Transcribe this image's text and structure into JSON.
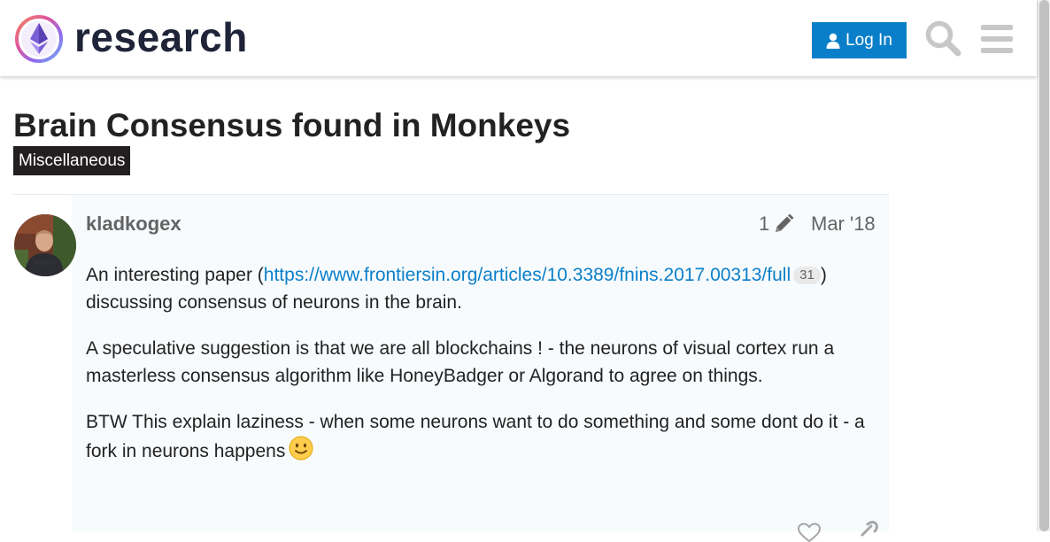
{
  "header": {
    "brand": "research",
    "logo_icon": "ethereum-research-logo-icon",
    "login_label": "Log In",
    "login_icon": "user-icon",
    "search_icon": "search-icon",
    "menu_icon": "hamburger-menu-icon",
    "login_color": "#0a7fc9"
  },
  "topic": {
    "title": "Brain Consensus found in Monkeys",
    "category": "Miscellaneous",
    "category_color": "#231f20"
  },
  "post": {
    "username": "kladkogex",
    "edit_count": "1",
    "edit_icon": "pencil-icon",
    "date": "Mar '18",
    "paragraphs": {
      "p1_before": "An interesting paper (",
      "p1_link": "https://www.frontiersin.org/articles/10.3389/fnins.2017.00313/full",
      "p1_clicks": "31",
      "p1_after": ") discussing consensus of neurons in the brain.",
      "p2": "A speculative suggestion is that we are all blockchains ! - the neurons of visual cortex run a masterless consensus algorithm like HoneyBadger or Algorand to agree on things.",
      "p3": "BTW This explain laziness - when some neurons want to do something and some dont do it - a fork in neurons happens"
    },
    "emoji": "slightly-smiling-face-emoji",
    "like_icon": "heart-icon",
    "share_icon": "link-icon"
  }
}
